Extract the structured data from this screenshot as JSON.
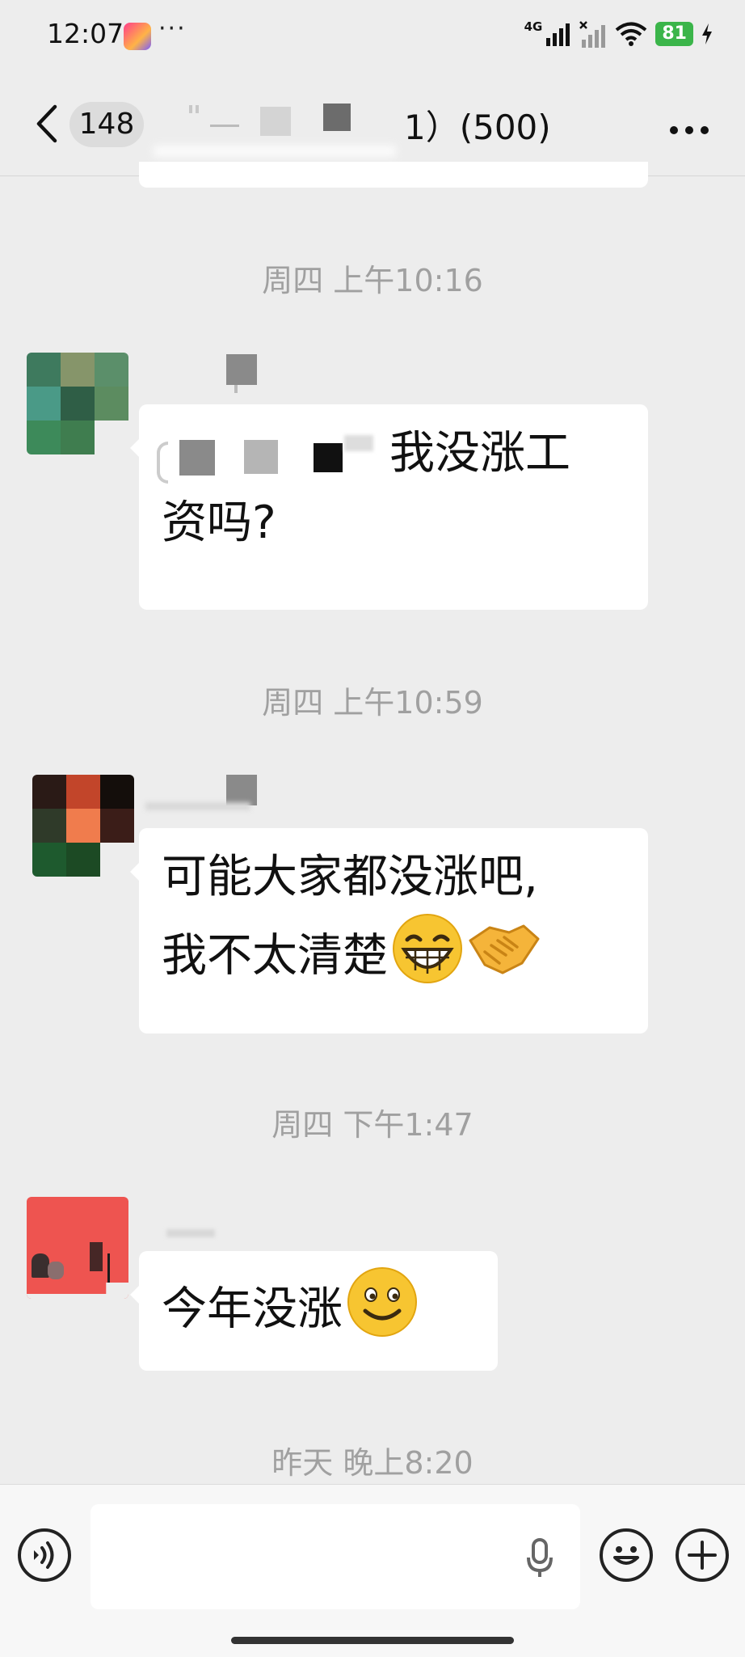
{
  "status_bar": {
    "time": "12:07",
    "dots": "···",
    "network": "4G",
    "battery": "81"
  },
  "header": {
    "back_icon": "chevron-left-icon",
    "unread_count": "148",
    "title_suffix": "1）(500)",
    "more_icon": "more-dots-icon"
  },
  "messages": [
    {
      "timestamp": "周四 上午10:16",
      "text_line1": "我没涨工",
      "text_line2": "资吗?"
    },
    {
      "timestamp": "周四 上午10:59",
      "text_line1": "可能大家都没涨吧,",
      "text_line2": "我不太清楚",
      "emojis": [
        "grin-emoji",
        "handshake-emoji"
      ]
    },
    {
      "timestamp": "周四 下午1:47",
      "text_line1": "今年没涨",
      "emojis": [
        "smile-emoji"
      ]
    }
  ],
  "last_timestamp": "昨天 晚上8:20",
  "input_bar": {
    "voice_icon": "voice-toggle-icon",
    "mic_icon": "microphone-icon",
    "emoji_icon": "emoji-icon",
    "plus_icon": "plus-icon"
  }
}
